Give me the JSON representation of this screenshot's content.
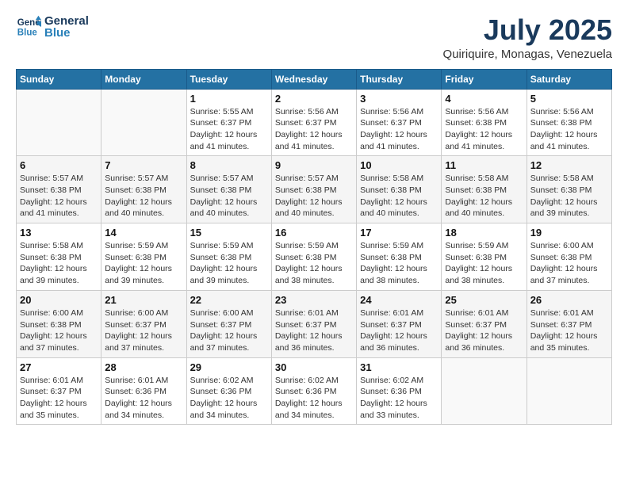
{
  "header": {
    "logo_line1": "General",
    "logo_line2": "Blue",
    "month_title": "July 2025",
    "location": "Quiriquire, Monagas, Venezuela"
  },
  "days_of_week": [
    "Sunday",
    "Monday",
    "Tuesday",
    "Wednesday",
    "Thursday",
    "Friday",
    "Saturday"
  ],
  "weeks": [
    [
      {
        "num": "",
        "detail": ""
      },
      {
        "num": "",
        "detail": ""
      },
      {
        "num": "1",
        "detail": "Sunrise: 5:55 AM\nSunset: 6:37 PM\nDaylight: 12 hours and 41 minutes."
      },
      {
        "num": "2",
        "detail": "Sunrise: 5:56 AM\nSunset: 6:37 PM\nDaylight: 12 hours and 41 minutes."
      },
      {
        "num": "3",
        "detail": "Sunrise: 5:56 AM\nSunset: 6:37 PM\nDaylight: 12 hours and 41 minutes."
      },
      {
        "num": "4",
        "detail": "Sunrise: 5:56 AM\nSunset: 6:38 PM\nDaylight: 12 hours and 41 minutes."
      },
      {
        "num": "5",
        "detail": "Sunrise: 5:56 AM\nSunset: 6:38 PM\nDaylight: 12 hours and 41 minutes."
      }
    ],
    [
      {
        "num": "6",
        "detail": "Sunrise: 5:57 AM\nSunset: 6:38 PM\nDaylight: 12 hours and 41 minutes."
      },
      {
        "num": "7",
        "detail": "Sunrise: 5:57 AM\nSunset: 6:38 PM\nDaylight: 12 hours and 40 minutes."
      },
      {
        "num": "8",
        "detail": "Sunrise: 5:57 AM\nSunset: 6:38 PM\nDaylight: 12 hours and 40 minutes."
      },
      {
        "num": "9",
        "detail": "Sunrise: 5:57 AM\nSunset: 6:38 PM\nDaylight: 12 hours and 40 minutes."
      },
      {
        "num": "10",
        "detail": "Sunrise: 5:58 AM\nSunset: 6:38 PM\nDaylight: 12 hours and 40 minutes."
      },
      {
        "num": "11",
        "detail": "Sunrise: 5:58 AM\nSunset: 6:38 PM\nDaylight: 12 hours and 40 minutes."
      },
      {
        "num": "12",
        "detail": "Sunrise: 5:58 AM\nSunset: 6:38 PM\nDaylight: 12 hours and 39 minutes."
      }
    ],
    [
      {
        "num": "13",
        "detail": "Sunrise: 5:58 AM\nSunset: 6:38 PM\nDaylight: 12 hours and 39 minutes."
      },
      {
        "num": "14",
        "detail": "Sunrise: 5:59 AM\nSunset: 6:38 PM\nDaylight: 12 hours and 39 minutes."
      },
      {
        "num": "15",
        "detail": "Sunrise: 5:59 AM\nSunset: 6:38 PM\nDaylight: 12 hours and 39 minutes."
      },
      {
        "num": "16",
        "detail": "Sunrise: 5:59 AM\nSunset: 6:38 PM\nDaylight: 12 hours and 38 minutes."
      },
      {
        "num": "17",
        "detail": "Sunrise: 5:59 AM\nSunset: 6:38 PM\nDaylight: 12 hours and 38 minutes."
      },
      {
        "num": "18",
        "detail": "Sunrise: 5:59 AM\nSunset: 6:38 PM\nDaylight: 12 hours and 38 minutes."
      },
      {
        "num": "19",
        "detail": "Sunrise: 6:00 AM\nSunset: 6:38 PM\nDaylight: 12 hours and 37 minutes."
      }
    ],
    [
      {
        "num": "20",
        "detail": "Sunrise: 6:00 AM\nSunset: 6:38 PM\nDaylight: 12 hours and 37 minutes."
      },
      {
        "num": "21",
        "detail": "Sunrise: 6:00 AM\nSunset: 6:37 PM\nDaylight: 12 hours and 37 minutes."
      },
      {
        "num": "22",
        "detail": "Sunrise: 6:00 AM\nSunset: 6:37 PM\nDaylight: 12 hours and 37 minutes."
      },
      {
        "num": "23",
        "detail": "Sunrise: 6:01 AM\nSunset: 6:37 PM\nDaylight: 12 hours and 36 minutes."
      },
      {
        "num": "24",
        "detail": "Sunrise: 6:01 AM\nSunset: 6:37 PM\nDaylight: 12 hours and 36 minutes."
      },
      {
        "num": "25",
        "detail": "Sunrise: 6:01 AM\nSunset: 6:37 PM\nDaylight: 12 hours and 36 minutes."
      },
      {
        "num": "26",
        "detail": "Sunrise: 6:01 AM\nSunset: 6:37 PM\nDaylight: 12 hours and 35 minutes."
      }
    ],
    [
      {
        "num": "27",
        "detail": "Sunrise: 6:01 AM\nSunset: 6:37 PM\nDaylight: 12 hours and 35 minutes."
      },
      {
        "num": "28",
        "detail": "Sunrise: 6:01 AM\nSunset: 6:36 PM\nDaylight: 12 hours and 34 minutes."
      },
      {
        "num": "29",
        "detail": "Sunrise: 6:02 AM\nSunset: 6:36 PM\nDaylight: 12 hours and 34 minutes."
      },
      {
        "num": "30",
        "detail": "Sunrise: 6:02 AM\nSunset: 6:36 PM\nDaylight: 12 hours and 34 minutes."
      },
      {
        "num": "31",
        "detail": "Sunrise: 6:02 AM\nSunset: 6:36 PM\nDaylight: 12 hours and 33 minutes."
      },
      {
        "num": "",
        "detail": ""
      },
      {
        "num": "",
        "detail": ""
      }
    ]
  ]
}
